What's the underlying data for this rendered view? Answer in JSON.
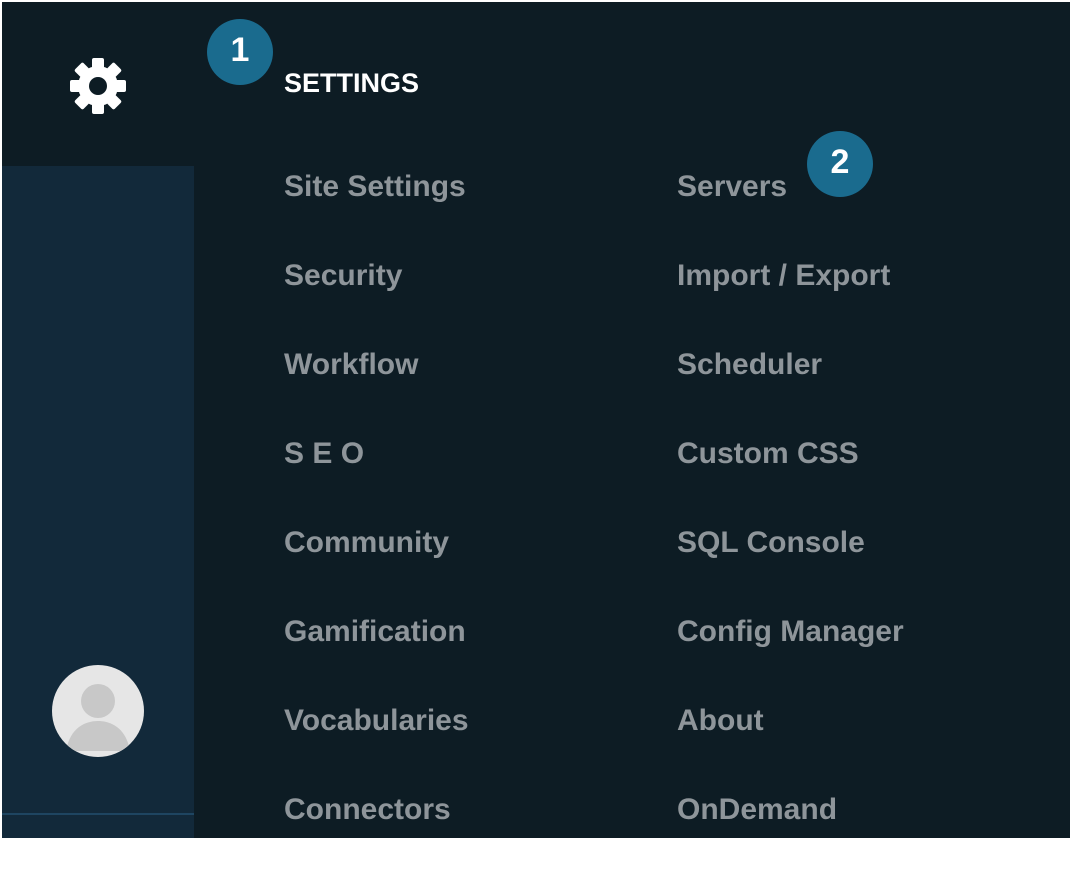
{
  "sidebar": {
    "settings_icon": "gear-icon",
    "avatar_icon": "user-avatar-icon"
  },
  "menu": {
    "title": "SETTINGS",
    "left_items": [
      "Site Settings",
      "Security",
      "Workflow",
      "S E O",
      "Community",
      "Gamification",
      "Vocabularies",
      "Connectors"
    ],
    "right_items": [
      "Servers",
      "Import / Export",
      "Scheduler",
      "Custom CSS",
      "SQL Console",
      "Config Manager",
      "About",
      "OnDemand"
    ]
  },
  "callouts": [
    "1",
    "2"
  ],
  "colors": {
    "panel_bg": "#0d1c24",
    "rail_bg": "#12293a",
    "badge": "#1a6b8e",
    "item_text": "#8e959a",
    "title_text": "#ffffff"
  }
}
